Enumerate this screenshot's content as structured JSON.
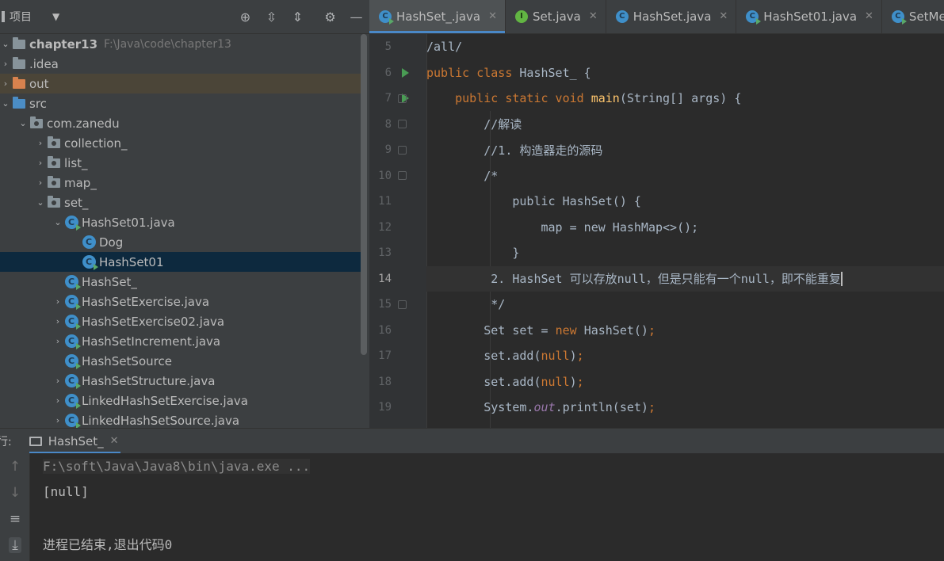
{
  "project": {
    "title": "项目",
    "tree": [
      {
        "label": "chapter13",
        "path": "F:\\Java\\code\\chapter13"
      },
      {
        "label": ".idea"
      },
      {
        "label": "out"
      },
      {
        "label": "src"
      },
      {
        "label": "com.zanedu"
      },
      {
        "label": "collection_"
      },
      {
        "label": "list_"
      },
      {
        "label": "map_"
      },
      {
        "label": "set_"
      },
      {
        "label": "HashSet01.java"
      },
      {
        "label": "Dog"
      },
      {
        "label": "HashSet01"
      },
      {
        "label": "HashSet_"
      },
      {
        "label": "HashSetExercise.java"
      },
      {
        "label": "HashSetExercise02.java"
      },
      {
        "label": "HashSetIncrement.java"
      },
      {
        "label": "HashSetSource"
      },
      {
        "label": "HashSetStructure.java"
      },
      {
        "label": "LinkedHashSetExercise.java"
      },
      {
        "label": "LinkedHashSetSource.java"
      }
    ]
  },
  "tabs": [
    {
      "label": "HashSet_.java",
      "icon": "class-icon",
      "active": true
    },
    {
      "label": "Set.java",
      "icon": "interface-icon"
    },
    {
      "label": "HashSet.java",
      "icon": "class-icon"
    },
    {
      "label": "HashSet01.java",
      "icon": "class-icon"
    },
    {
      "label": "SetMeth",
      "icon": "class-icon"
    }
  ],
  "code": {
    "line_numbers": [
      "5",
      "6",
      "7",
      "8",
      "9",
      "10",
      "11",
      "12",
      "13",
      "14",
      "15",
      "16",
      "17",
      "18",
      "19"
    ],
    "current_line": "14",
    "l5": "/all/",
    "l6a": "public class ",
    "l6b": "HashSet_",
    "l6c": " {",
    "l7a": "    public static void ",
    "l7b": "main",
    "l7c": "(String[] args) {",
    "l8": "        //解读",
    "l9": "        //1. 构造器走的源码",
    "l10": "        /*",
    "l11": "            public HashSet() {",
    "l12": "                map = new HashMap<>();",
    "l13": "            }",
    "l14": "         2. HashSet 可以存放null，但是只能有一个null，即不能重复",
    "l15": "         */",
    "l16a": "        Set set = ",
    "l16b": "new ",
    "l16c": "HashSet()",
    "l16d": ";",
    "l17a": "        set.add(",
    "l17b": "null",
    "l17c": ")",
    "l17d": ";",
    "l18a": "        set.add(",
    "l18b": "null",
    "l18c": ")",
    "l18d": ";",
    "l19a": "        System.",
    "l19b": "out",
    "l19c": ".println(set)",
    "l19d": ";"
  },
  "run": {
    "label": "行:",
    "tab": "HashSet_",
    "console": [
      "F:\\soft\\Java\\Java8\\bin\\java.exe ...",
      "[null]",
      "",
      "进程已结束,退出代码0"
    ]
  }
}
